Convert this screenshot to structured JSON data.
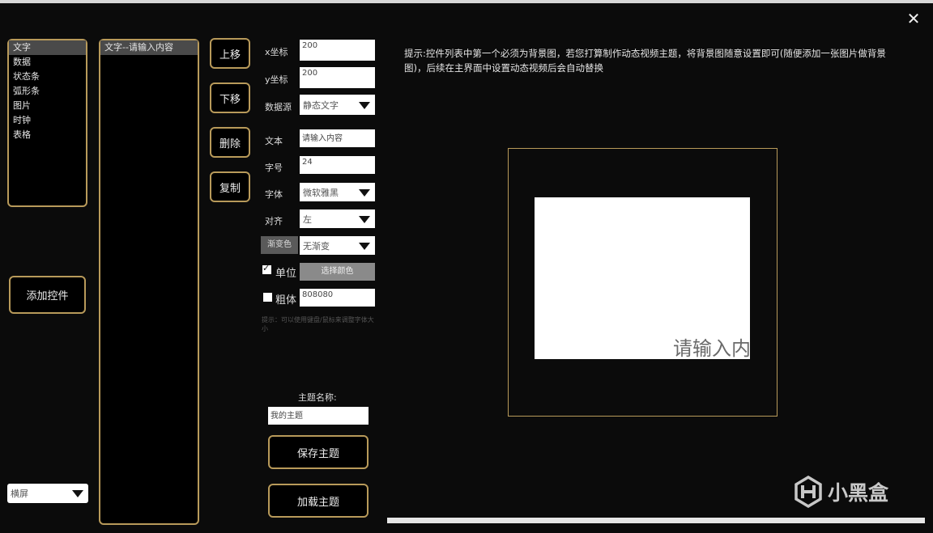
{
  "window": {
    "close_glyph": "✕"
  },
  "type_list": [
    "文字",
    "数据",
    "状态条",
    "弧形条",
    "图片",
    "时钟",
    "表格"
  ],
  "control_list": [
    "文字--请输入内容"
  ],
  "buttons": {
    "up": "上移",
    "down": "下移",
    "delete": "删除",
    "copy": "复制",
    "add_control": "添加控件",
    "save_theme": "保存主题",
    "load_theme": "加载主题",
    "choose_color": "选择颜色"
  },
  "props": {
    "x_label": "x坐标",
    "x_value": "200",
    "y_label": "y坐标",
    "y_value": "200",
    "source_label": "数据源",
    "source_value": "静态文字",
    "text_label": "文本",
    "text_value": "请输入内容",
    "size_label": "字号",
    "size_value": "24",
    "font_label": "字体",
    "font_value": "微软雅黑",
    "align_label": "对齐",
    "align_value": "左",
    "gradient_label": "渐变色",
    "gradient_value": "无渐变",
    "unit_label": "单位",
    "unit_checked": true,
    "bold_label": "粗体",
    "bold_checked": false,
    "color_value": "808080",
    "hint": "提示：可以使用键盘/鼠标来调整字体大小"
  },
  "theme": {
    "name_label": "主题名称:",
    "name_value": "我的主题"
  },
  "orientation": {
    "value": "横屏"
  },
  "tip": "提示:控件列表中第一个必须为背景图，若您打算制作动态视频主题，将背景图随意设置即可(随便添加一张图片做背景图)，后续在主界面中设置动态视频后会自动替换",
  "preview": {
    "text": "请输入内容"
  },
  "watermark": {
    "text": "小黑盒"
  },
  "colors": {
    "accent_border": "#b89a5a",
    "selected_bg": "#4a4a4a",
    "background": "#0b0b0b"
  }
}
